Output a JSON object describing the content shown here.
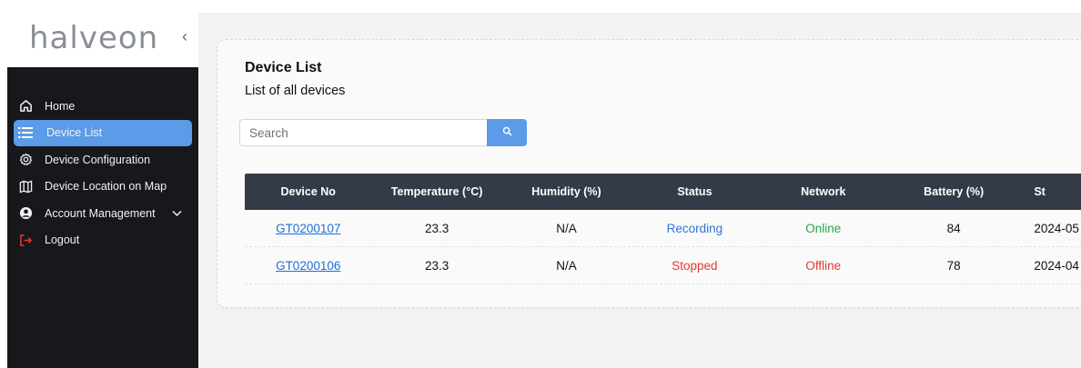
{
  "brand": {
    "logo_text": "halveon",
    "collapse_glyph": "‹"
  },
  "sidebar": {
    "items": [
      {
        "label": "Home",
        "icon": "home-icon"
      },
      {
        "label": "Device List",
        "icon": "list-icon",
        "active": true
      },
      {
        "label": "Device Configuration",
        "icon": "gear-icon"
      },
      {
        "label": "Device Location on Map",
        "icon": "map-icon"
      },
      {
        "label": "Account Management",
        "icon": "user-icon",
        "has_submenu": true
      },
      {
        "label": "Logout",
        "icon": "logout-icon",
        "color": "#e53935"
      }
    ]
  },
  "main": {
    "title": "Device List",
    "subtitle": "List of all devices",
    "search": {
      "placeholder": "Search",
      "value": ""
    },
    "table": {
      "headers": [
        "Device No",
        "Temperature (°C)",
        "Humidity (%)",
        "Status",
        "Network",
        "Battery (%)",
        "St"
      ],
      "rows": [
        {
          "device_no": "GT0200107",
          "temperature": "23.3",
          "humidity": "N/A",
          "status": "Recording",
          "network": "Online",
          "battery": "84",
          "start": "2024-05"
        },
        {
          "device_no": "GT0200106",
          "temperature": "23.3",
          "humidity": "N/A",
          "status": "Stopped",
          "network": "Offline",
          "battery": "78",
          "start": "2024-04"
        }
      ]
    }
  },
  "colors": {
    "accent": "#5b9be8",
    "sidebar_bg": "#16181c",
    "table_header_bg": "#343b48",
    "status_recording": "#2d78d6",
    "status_stopped": "#e53935",
    "network_online": "#28a745",
    "network_offline": "#e53935"
  }
}
